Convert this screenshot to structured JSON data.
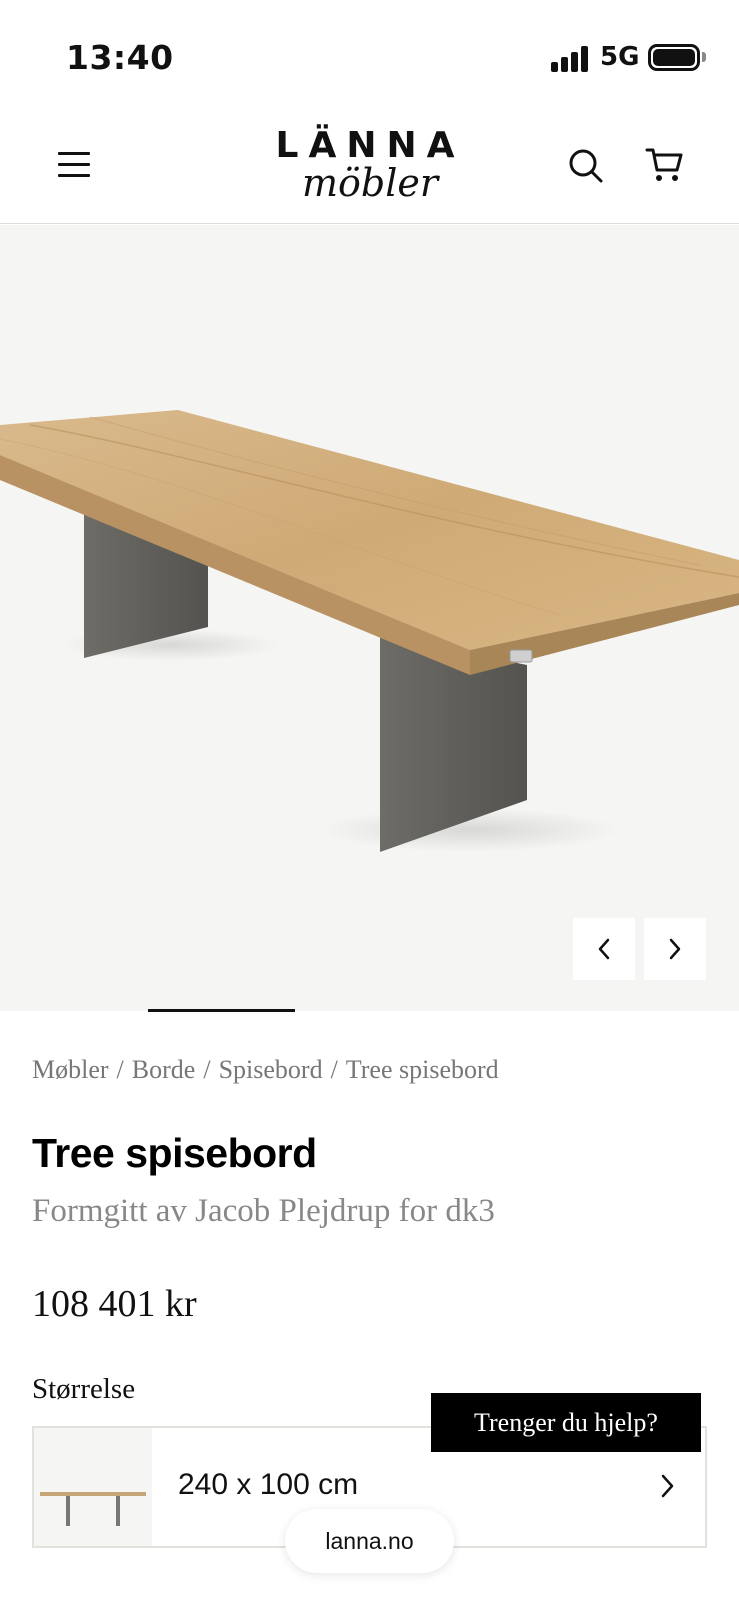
{
  "status_bar": {
    "time": "13:40",
    "network": "5G"
  },
  "header": {
    "logo_top": "LÄNNA",
    "logo_bottom": "möbler",
    "icons": [
      "menu-icon",
      "search-icon",
      "cart-icon"
    ]
  },
  "gallery": {
    "prev_icon": "chevron-left-icon",
    "next_icon": "chevron-right-icon"
  },
  "breadcrumb": [
    "Møbler",
    "Borde",
    "Spisebord",
    "Tree spisebord"
  ],
  "product": {
    "title": "Tree spisebord",
    "subtitle": "Formgitt av Jacob Plejdrup for dk3",
    "price": "108 401 kr",
    "size_label": "Størrelse",
    "size_value": "240 x 100 cm"
  },
  "help_button": "Trenger du hjelp?",
  "browser": {
    "url": "lanna.no"
  },
  "colors": {
    "hero_background": "#f5f5f3",
    "help_button_bg": "#000000",
    "breadcrumb_text": "#777777"
  }
}
